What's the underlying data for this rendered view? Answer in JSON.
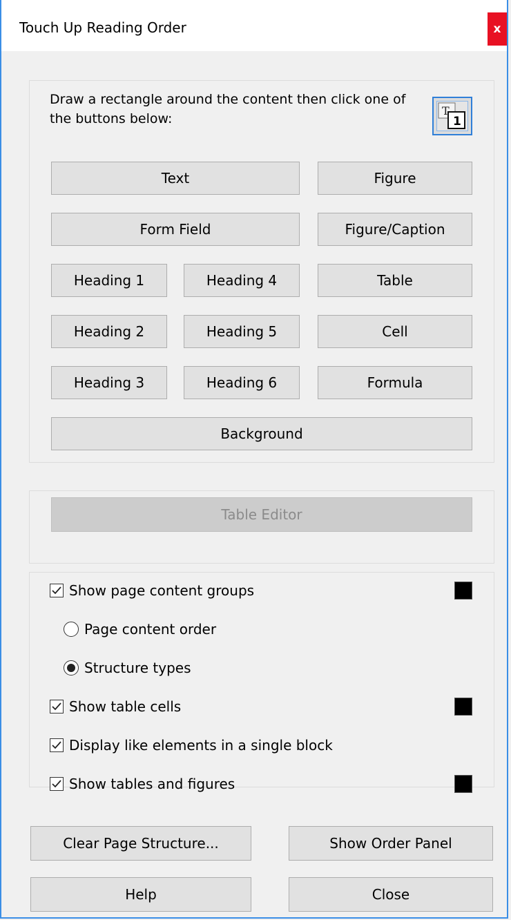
{
  "window": {
    "title": "Touch Up Reading Order",
    "close_glyph": "x"
  },
  "instructions": "Draw a rectangle around the content then click one of the buttons below:",
  "tag_icon": {
    "name": "touch-up-order-icon",
    "letter": "T",
    "number": "1"
  },
  "tag_buttons": {
    "text": "Text",
    "figure": "Figure",
    "form_field": "Form Field",
    "figure_caption": "Figure/Caption",
    "heading1": "Heading 1",
    "heading4": "Heading 4",
    "table": "Table",
    "heading2": "Heading 2",
    "heading5": "Heading 5",
    "cell": "Cell",
    "heading3": "Heading 3",
    "heading6": "Heading 6",
    "formula": "Formula",
    "background": "Background"
  },
  "table_editor": "Table Editor",
  "options": {
    "show_groups": {
      "label": "Show page content groups",
      "checked": true,
      "color": "#000000"
    },
    "page_order": {
      "label": "Page content order",
      "selected": false
    },
    "structure_types": {
      "label": "Structure types",
      "selected": true
    },
    "show_cells": {
      "label": "Show table cells",
      "checked": true,
      "color": "#000000"
    },
    "display_like": {
      "label": "Display like elements in a single block",
      "checked": true
    },
    "show_tables_figures": {
      "label": "Show tables and figures",
      "checked": true,
      "color": "#000000"
    }
  },
  "footer": {
    "clear": "Clear Page Structure...",
    "order_panel": "Show Order Panel",
    "help": "Help",
    "close": "Close"
  },
  "colors": {
    "accent": "#3a8ee6",
    "close_bg": "#e81123"
  }
}
